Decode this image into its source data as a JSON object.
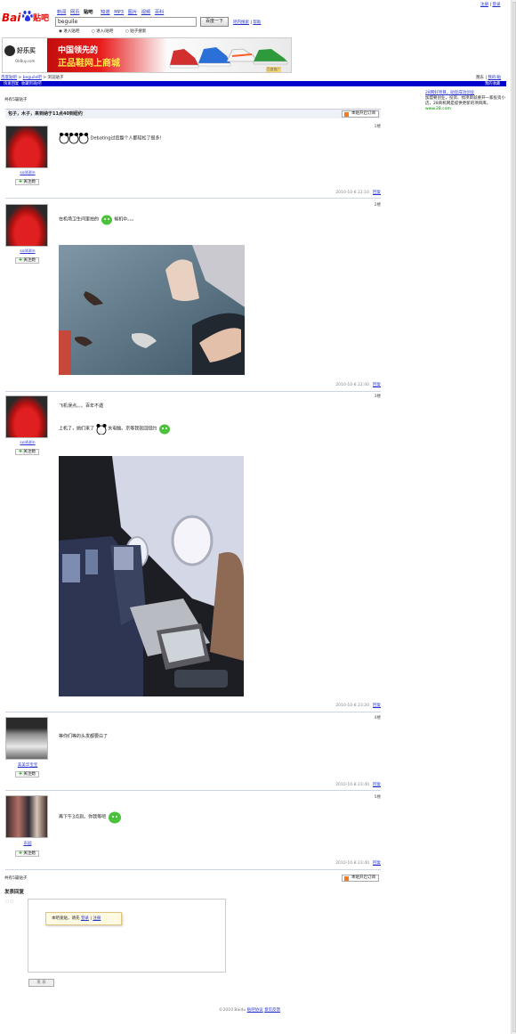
{
  "top_right": {
    "register": "注册",
    "sep": "|",
    "login": "登录"
  },
  "nav": {
    "items": [
      "新闻",
      "网页",
      "贴吧",
      "知道",
      "MP3",
      "图片",
      "视频",
      "百科"
    ]
  },
  "logo": {
    "text_bai": "Bai",
    "text_du": "du",
    "text_tieba": "贴吧"
  },
  "search": {
    "value": "beguile",
    "button": "百度一下",
    "help_links": [
      "吧内搜索",
      "帮助"
    ]
  },
  "radios": [
    "进入贴吧",
    "进入i贴吧",
    "贴子搜索"
  ],
  "banner": {
    "brand": "好乐买",
    "brand_url": "OkBuy.com",
    "headline_1": "中国领先的",
    "headline_2": "正品鞋网上商城",
    "tag": "百度推广"
  },
  "breadcrumb": {
    "home": "百度贴吧",
    "sep": ">",
    "bar": "beguile吧",
    "current": "浏览贴子"
  },
  "user_right": {
    "name": "翘东",
    "sep": "|",
    "my_i": "我的i贴"
  },
  "blue_bar": {
    "left_1": "快速回复",
    "left_2": "收藏到i贴吧",
    "right": "我的收藏"
  },
  "post_count": "共有5篇贴子",
  "thread": {
    "title": "包子，木子，来到纳于11点40到纽约",
    "rss": "本贴开启订阅",
    "rss_bottom": "本贴开启订阅"
  },
  "posts": [
    {
      "user": "sol4illIn",
      "follow": "关注她",
      "floor": "1楼",
      "text_1": "",
      "text_2": "Debating过后整个人都轻松了很多！",
      "date": "2010-10-8 22:10",
      "reply": "回复"
    },
    {
      "user": "sol4illIn",
      "follow": "关注她",
      "floor": "2楼",
      "text_1": "在机场卫生间里拍的",
      "text_2": "候机中。。。",
      "date": "2010-10-8 22:40",
      "reply": "回复"
    },
    {
      "user": "sol4illIn",
      "follow": "关注她",
      "floor": "3楼",
      "text_1": "飞机误点。。。百年不遇",
      "text_2": "上机了，她们来了",
      "text_3": "关电脑。京等我就回纽约",
      "date": "2010-10-8 23:20",
      "reply": "回复"
    },
    {
      "user": "美美华宝宝",
      "follow": "关注她",
      "floor": "4楼",
      "text_1": "等你们等的头发都要白了",
      "date": "2010-10-8 23:40",
      "reply": "回复"
    },
    {
      "user": "东园",
      "follow": "关注她",
      "floor": "5楼",
      "text_1": "再下午3点到。你我等吧",
      "date": "2010-10-8 23:40",
      "reply": "回复"
    }
  ],
  "sidebar": {
    "ad_title": "28网好项目，助您成功创业",
    "ad_body": "加盟要创业，投资、找项目就要开一家投资小店，28商机网是提供更新的项目库。",
    "ad_url": "www.28.com"
  },
  "reply_section": {
    "title": "发表回复",
    "tip": "本吧发贴，请先",
    "login": "登录",
    "sep": "|",
    "register": "注册",
    "submit": "发 表"
  },
  "footer": {
    "copyright": "©2010 Baidu",
    "link_1": "贴吧协议",
    "link_2": "意见反馈"
  },
  "colors": {
    "link": "#2633cc",
    "blue_bar": "#0000cc",
    "logo_red": "#e10601",
    "logo_blue": "#2932e1"
  }
}
